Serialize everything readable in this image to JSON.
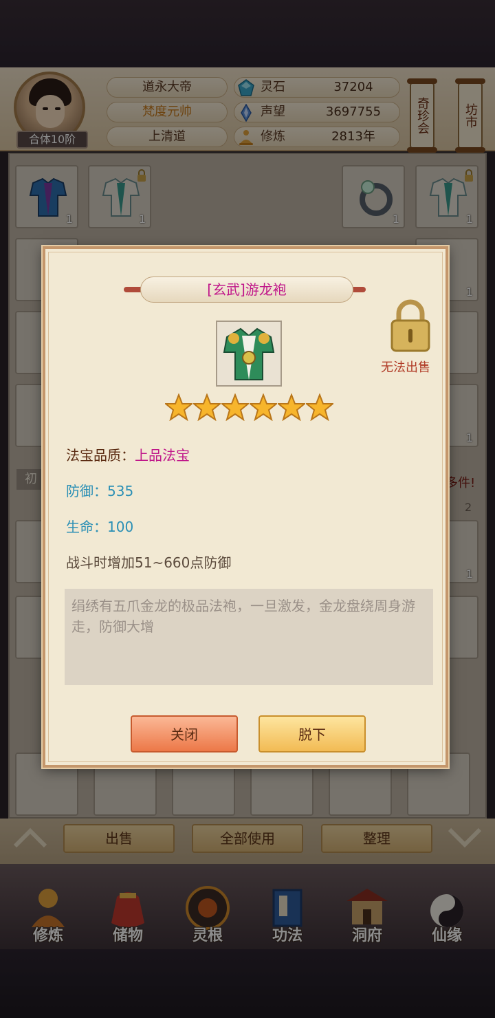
{
  "header": {
    "rank_badge": "合体10阶",
    "names": [
      "道永大帝",
      "梵度元帅",
      "上清道"
    ],
    "resources": [
      {
        "name": "灵石",
        "value": "37204",
        "icon": "spirit-stone-icon"
      },
      {
        "name": "声望",
        "value": "3697755",
        "icon": "prestige-crystal-icon"
      },
      {
        "name": "修炼",
        "value": "2813年",
        "icon": "meditation-icon"
      }
    ],
    "scrolls": [
      "奇珍会",
      "坊市"
    ]
  },
  "inventory": {
    "side_label": "初",
    "more_label": "多件!",
    "page_number": "2",
    "counts": [
      "1",
      "1",
      "1",
      "1",
      "1",
      "1",
      "1",
      "1"
    ]
  },
  "action_bar": {
    "sell": "出售",
    "use_all": "全部使用",
    "sort": "整理"
  },
  "nav": [
    {
      "label": "修炼",
      "icon": "cultivation-icon"
    },
    {
      "label": "储物",
      "icon": "storage-bag-icon"
    },
    {
      "label": "灵根",
      "icon": "spirit-root-icon"
    },
    {
      "label": "功法",
      "icon": "technique-book-icon"
    },
    {
      "label": "洞府",
      "icon": "cave-mansion-icon"
    },
    {
      "label": "仙缘",
      "icon": "immortal-fate-icon"
    }
  ],
  "dialog": {
    "title": "[玄武]游龙袍",
    "stars": 6,
    "cannot_sell": "无法出售",
    "quality_label": "法宝品质：",
    "quality_value": "上品法宝",
    "defense": "防御：535",
    "life": "生命：100",
    "effect": "战斗时增加51~660点防御",
    "description": "绢绣有五爪金龙的极品法袍，一旦激发，金龙盘绕周身游走，防御大增",
    "close_button": "关闭",
    "unequip_button": "脱下"
  },
  "colors": {
    "title": "#c0178a",
    "quality": "#c0178a",
    "stat": "#2a8fb5",
    "effect": "#5b4a3c",
    "cannot_sell": "#b03a26"
  }
}
